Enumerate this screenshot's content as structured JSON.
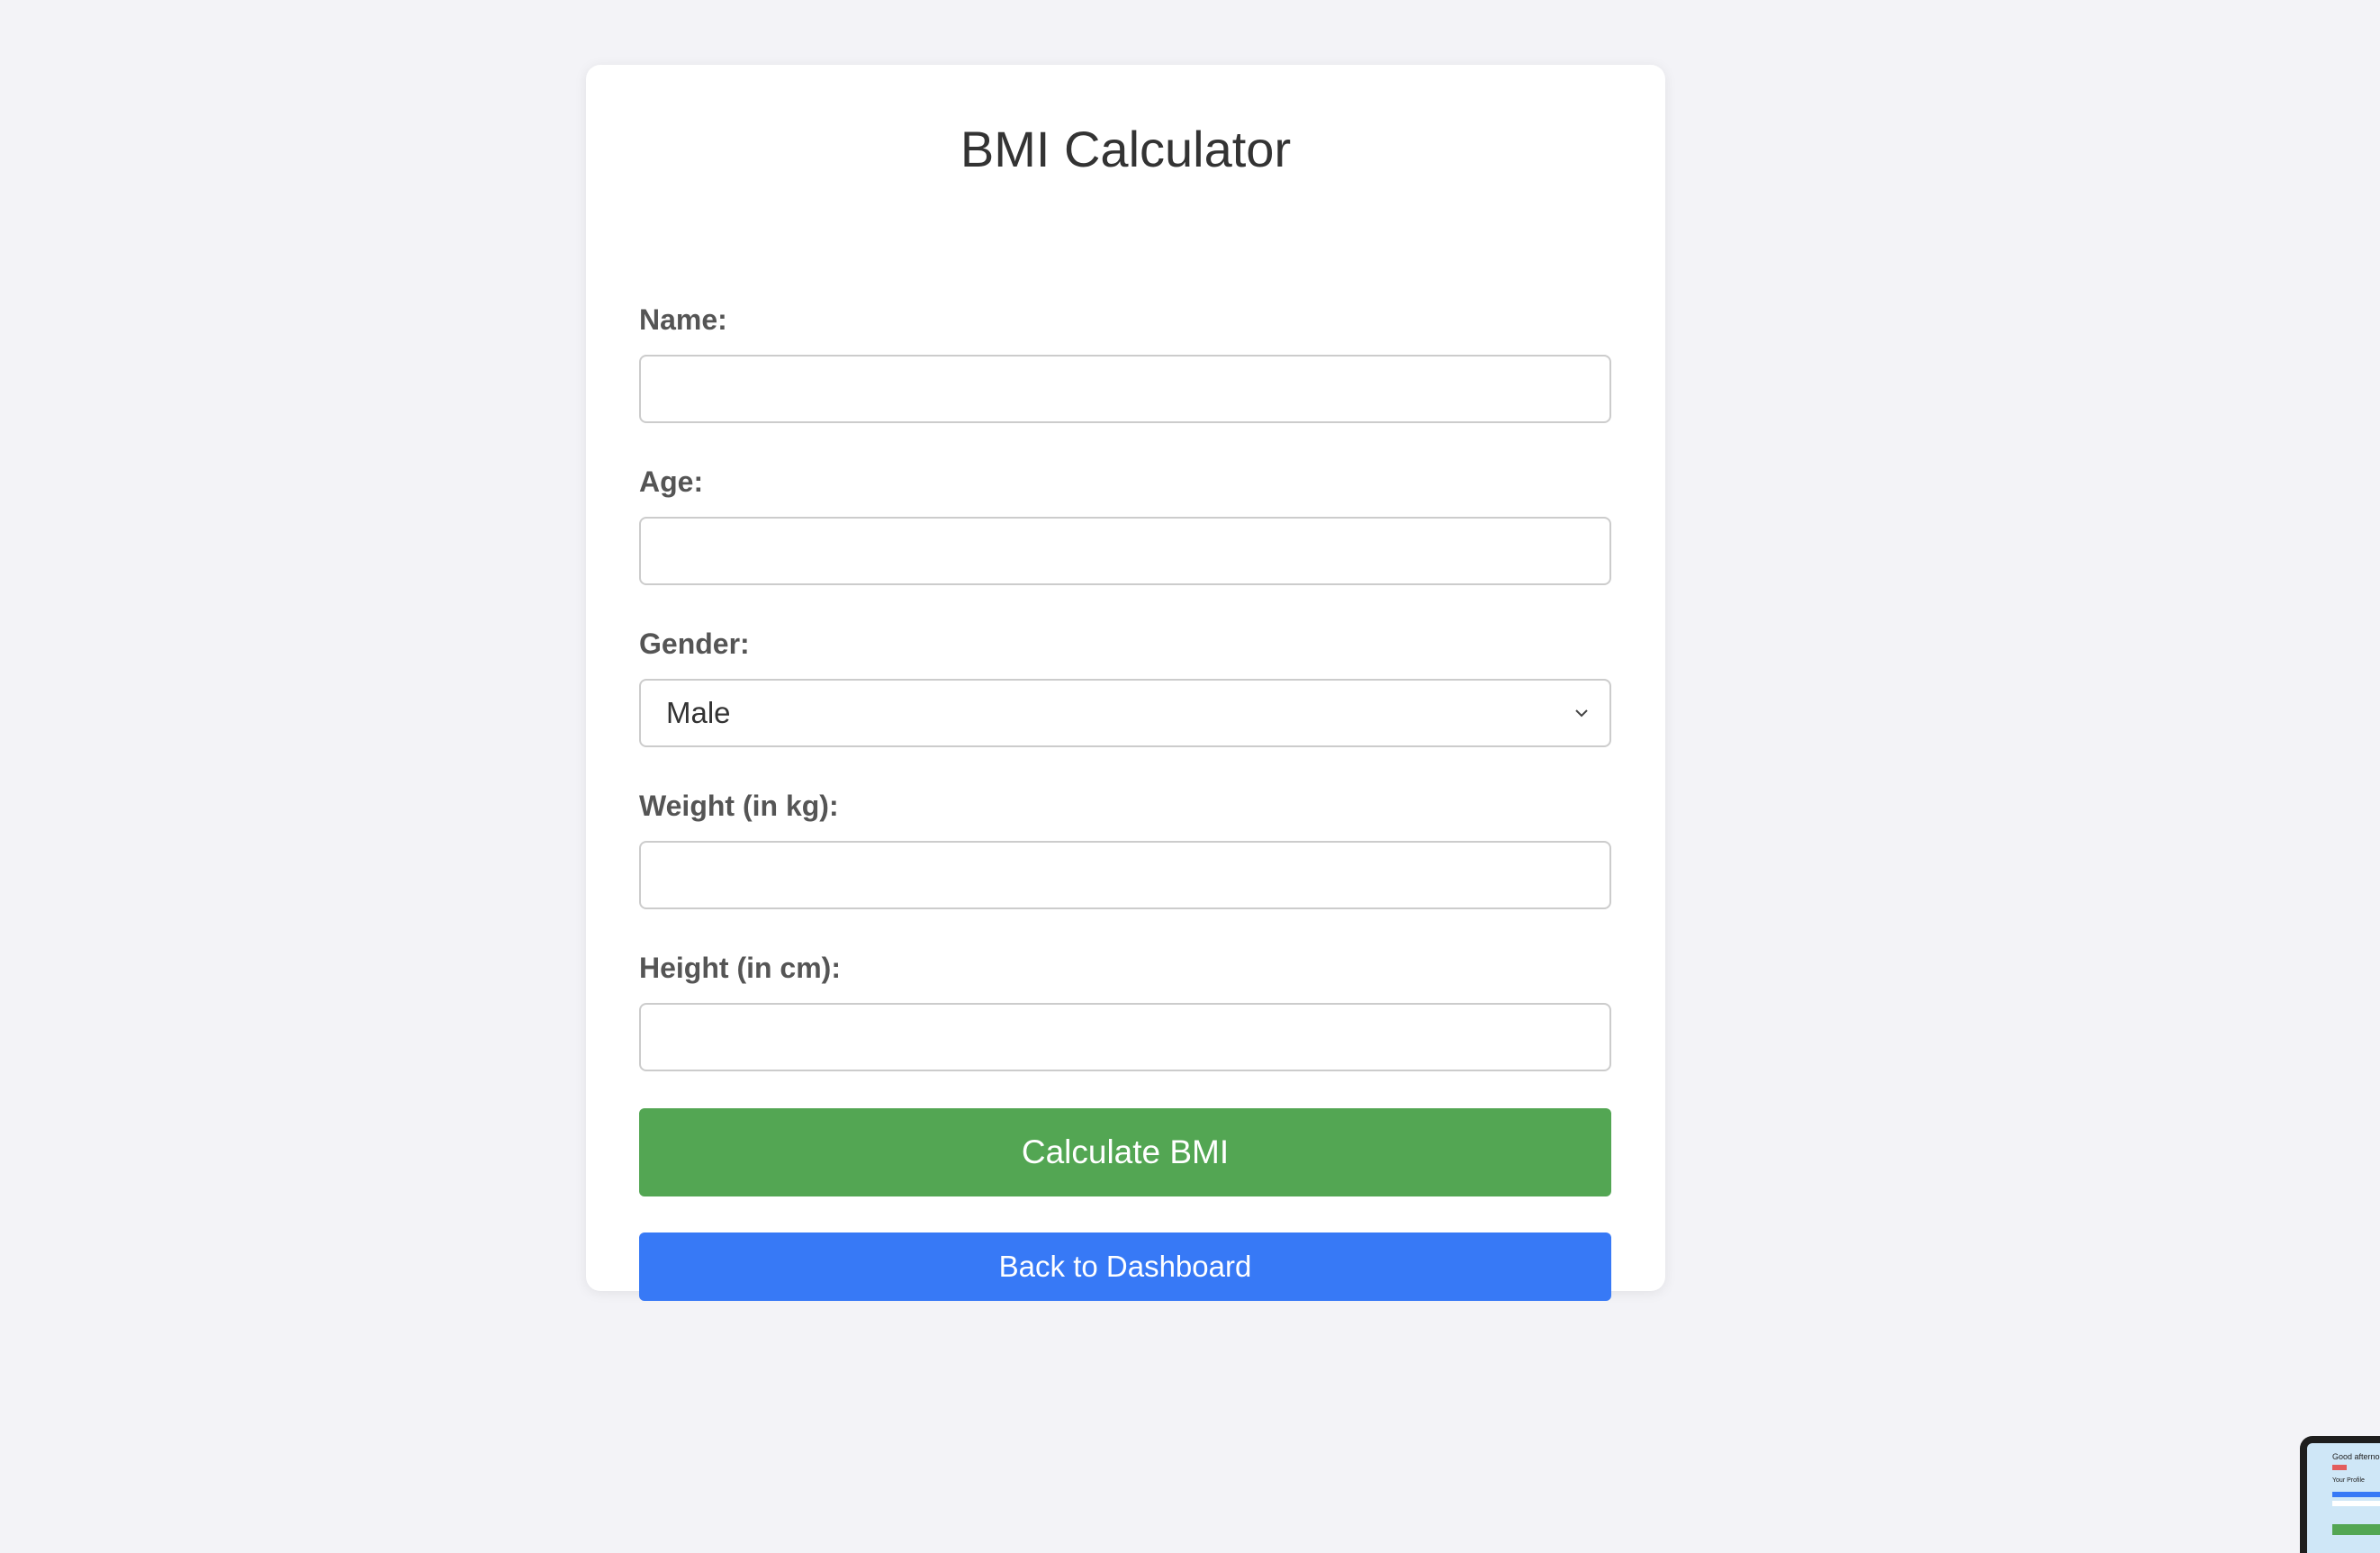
{
  "page": {
    "title": "BMI Calculator"
  },
  "form": {
    "name_label": "Name:",
    "name_value": "",
    "age_label": "Age:",
    "age_value": "",
    "gender_label": "Gender:",
    "gender_selected": "Male",
    "weight_label": "Weight (in kg):",
    "weight_value": "",
    "height_label": "Height (in cm):",
    "height_value": ""
  },
  "buttons": {
    "calculate_label": "Calculate BMI",
    "back_label": "Back to Dashboard"
  },
  "colors": {
    "background": "#f3f3f7",
    "calculate_button": "#53a653",
    "back_button": "#3779f6"
  },
  "preview_thumbnail": {
    "greeting": "Good afternoo",
    "section": "Your Profile"
  }
}
